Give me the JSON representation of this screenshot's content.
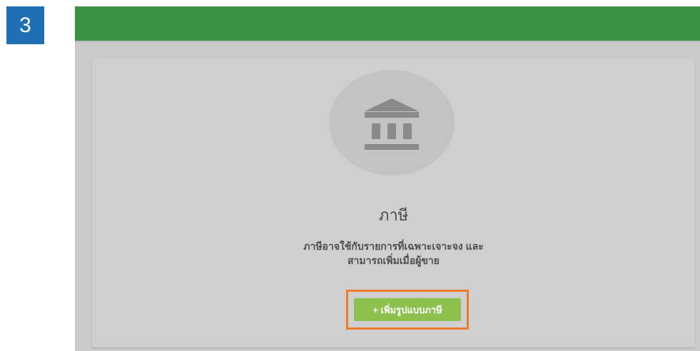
{
  "step": {
    "number": "3"
  },
  "empty_state": {
    "icon": "bank-icon",
    "title": "ภาษี",
    "description_line1": "ภาษีอาจใช้กับรายการที่เฉพาะเจาะจง และ",
    "description_line2": "สามารถเพิ่มเมื่อผู้ขาย",
    "add_button_label": "+ เพิ่มรูปแบบภาษี"
  },
  "colors": {
    "header_bar": "#3a9243",
    "step_badge": "#1f6fb4",
    "add_button": "#8cc14e",
    "highlight_border": "#ec7a2a"
  }
}
